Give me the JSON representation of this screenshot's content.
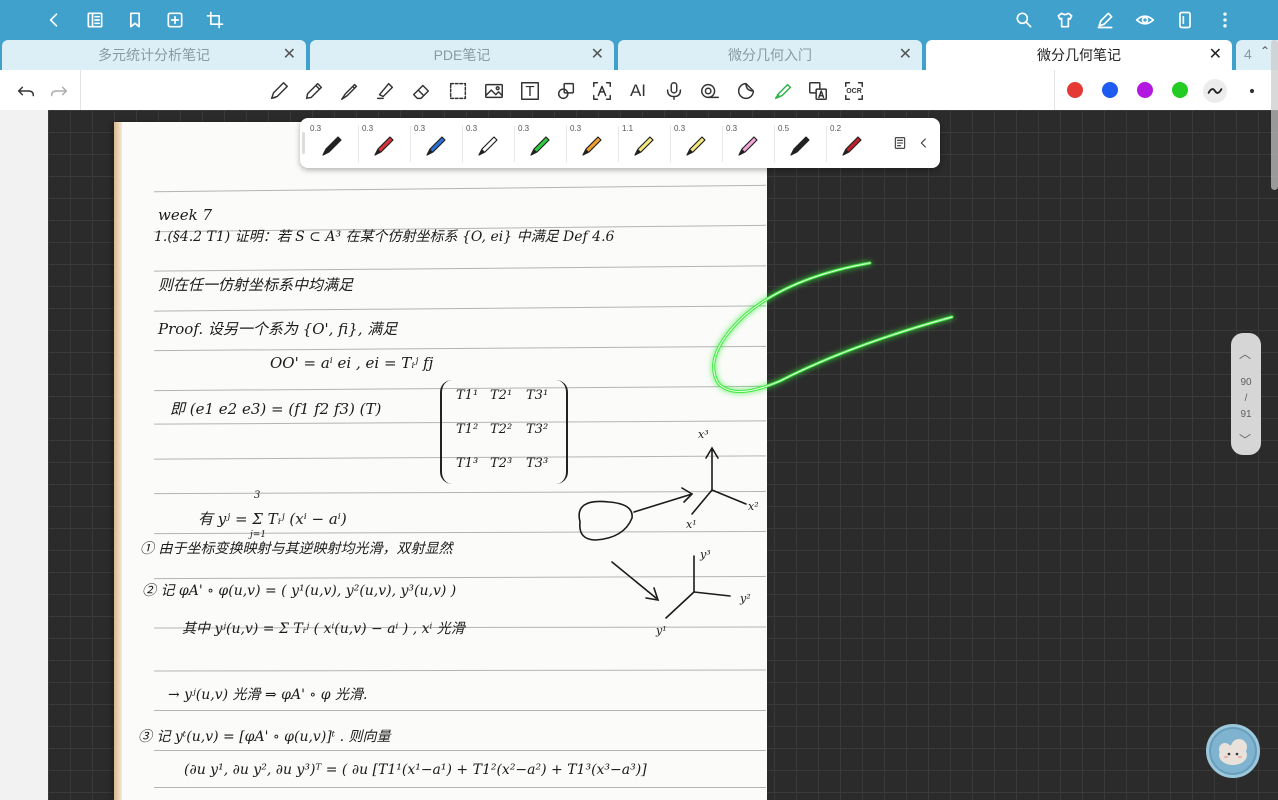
{
  "tabs": [
    {
      "label": "多元统计分析笔记",
      "active": false
    },
    {
      "label": "PDE笔记",
      "active": false
    },
    {
      "label": "微分几何入门",
      "active": false
    },
    {
      "label": "微分几何笔记",
      "active": true
    }
  ],
  "tab_more": {
    "count": "4"
  },
  "tab_close_glyph": "✕",
  "toolbar": {
    "text_tool": "T",
    "ai_tool": "AI",
    "ocr_tool": "OCR"
  },
  "palette": [
    {
      "name": "red",
      "color": "#e53935"
    },
    {
      "name": "blue",
      "color": "#1e5bf0"
    },
    {
      "name": "purple",
      "color": "#b318e0"
    },
    {
      "name": "green",
      "color": "#22cc22"
    }
  ],
  "pens": [
    {
      "width": "0.3",
      "color": "#222222"
    },
    {
      "width": "0.3",
      "color": "#d8323c"
    },
    {
      "width": "0.3",
      "color": "#2a6fd6"
    },
    {
      "width": "0.3",
      "color": "#ffffff"
    },
    {
      "width": "0.3",
      "color": "#2ecc40"
    },
    {
      "width": "0.3",
      "color": "#f0a030"
    },
    {
      "width": "1.1",
      "color": "#f4e97a"
    },
    {
      "width": "0.3",
      "color": "#f4e97a"
    },
    {
      "width": "0.3",
      "color": "#f2a8d8"
    },
    {
      "width": "0.5",
      "color": "#222222"
    },
    {
      "width": "0.2",
      "color": "#c0202a"
    }
  ],
  "pager": {
    "current": "90",
    "slash": "/",
    "total": "91"
  },
  "note": {
    "lines": [
      "week 7",
      "1.(§4.2 T1) 证明：若 S ⊂ A³ 在某个仿射坐标系 {O, ei} 中满足 Def 4.6",
      "则在任一仿射坐标系中均满足",
      "Proof. 设另一个系为 {O', fi}, 满足",
      "OO' = aⁱ ei ,   ei = Tᵢʲ fj",
      "即 (e1 e2 e3) = (f1 f2 f3) (T)",
      "有 yʲ = Σ Tᵢʲ (xⁱ − aⁱ)",
      "① 由于坐标变换映射与其逆映射均光滑，双射显然",
      "② 记 φA' ∘ φ(u,v) = ( y¹(u,v), y²(u,v), y³(u,v) )",
      "其中 yʲ(u,v) = Σ Tᵢʲ ( xⁱ(u,v) − aⁱ ) ,  xⁱ 光滑",
      "→ yʲ(u,v) 光滑 ⇒ φA' ∘ φ 光滑.",
      "③ 记 yᵗ(u,v) = [φA' ∘ φ(u,v)]ᵗ . 则向量",
      "(∂u y¹, ∂u y², ∂u y³)ᵀ = ( ∂u [T1¹(x¹−a¹) + T1²(x²−a²) + T1³(x³−a³)]"
    ],
    "matrix": [
      [
        "T1¹",
        "T2¹",
        "T3¹"
      ],
      [
        "T1²",
        "T2²",
        "T3²"
      ],
      [
        "T1³",
        "T2³",
        "T3³"
      ]
    ],
    "sum_upper": "3",
    "sum_lower": "j=1",
    "axes_top": {
      "z": "x³",
      "x": "x¹",
      "y": "x²"
    },
    "axes_bottom": {
      "z": "y³",
      "x": "y¹",
      "y": "y²"
    }
  }
}
